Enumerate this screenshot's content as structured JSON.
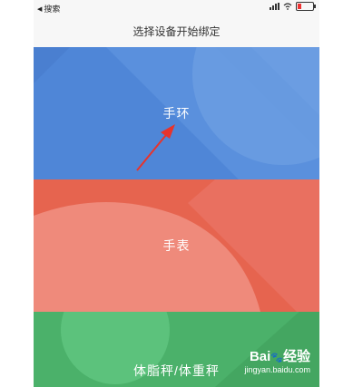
{
  "status_bar": {
    "back_label": "搜索"
  },
  "nav": {
    "title": "选择设备开始绑定"
  },
  "cards": {
    "band": {
      "label": "手环",
      "color": "#4f86d7"
    },
    "watch": {
      "label": "手表",
      "color": "#e6644f"
    },
    "scale": {
      "label": "体脂秤/体重秤",
      "color": "#4bb16a"
    }
  },
  "watermark": {
    "logo": "Bai",
    "suffix": "经验",
    "url": "jingyan.baidu.com"
  },
  "colors": {
    "annotation_arrow": "#e8332b"
  }
}
